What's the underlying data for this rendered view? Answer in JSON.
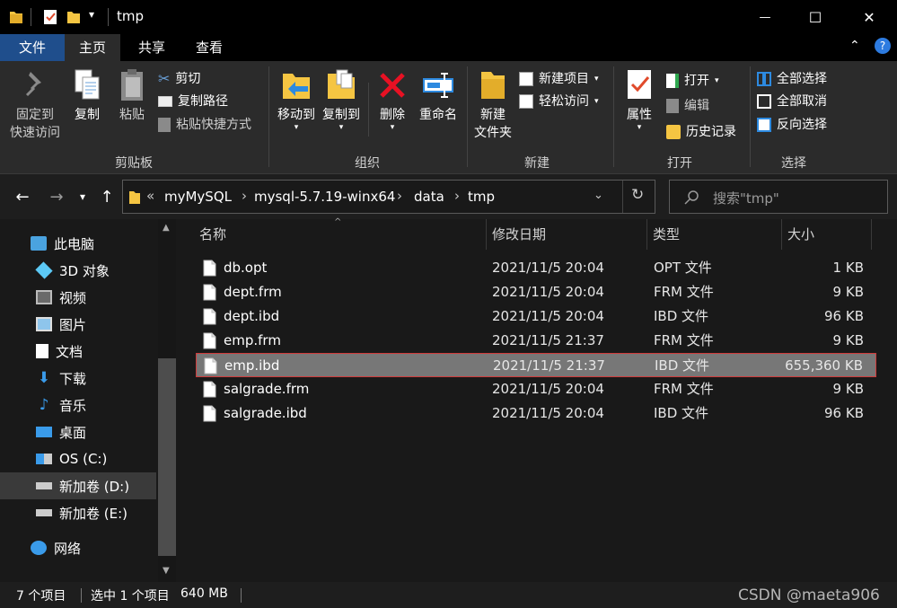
{
  "titlebar": {
    "title": "tmp",
    "qat_dropdown": "▾",
    "minimize": "—",
    "maximize": "☐",
    "close": "✕"
  },
  "tabs": [
    {
      "label": "文件"
    },
    {
      "label": "主页"
    },
    {
      "label": "共享"
    },
    {
      "label": "查看"
    }
  ],
  "ribbon": {
    "help": "?",
    "collapse": "⌃",
    "clipboard": {
      "group": "剪贴板",
      "pin_line1": "固定到",
      "pin_line2": "快速访问",
      "copy": "复制",
      "paste": "粘贴",
      "cut": "剪切",
      "copy_path": "复制路径",
      "paste_shortcut": "粘贴快捷方式"
    },
    "organize": {
      "group": "组织",
      "move_to": "移动到",
      "copy_to": "复制到",
      "delete": "删除",
      "rename": "重命名"
    },
    "new": {
      "group": "新建",
      "new_folder_line1": "新建",
      "new_folder_line2": "文件夹",
      "new_item": "新建项目",
      "easy_access": "轻松访问"
    },
    "open": {
      "group": "打开",
      "properties": "属性",
      "open": "打开",
      "edit": "编辑",
      "history": "历史记录"
    },
    "select": {
      "group": "选择",
      "select_all": "全部选择",
      "select_none": "全部取消",
      "invert": "反向选择"
    }
  },
  "address": {
    "overflow": "«",
    "crumbs": [
      "myMySQL",
      "mysql-5.7.19-winx64",
      "data",
      "tmp"
    ],
    "separator": "›",
    "search_placeholder": "搜索\"tmp\""
  },
  "nav": {
    "items": [
      {
        "label": "此电脑",
        "icon": "pc-icon"
      },
      {
        "label": "3D 对象",
        "icon": "cube-icon"
      },
      {
        "label": "视频",
        "icon": "video-icon"
      },
      {
        "label": "图片",
        "icon": "picture-icon"
      },
      {
        "label": "文档",
        "icon": "document-icon"
      },
      {
        "label": "下载",
        "icon": "download-icon"
      },
      {
        "label": "音乐",
        "icon": "music-icon"
      },
      {
        "label": "桌面",
        "icon": "desktop-icon"
      },
      {
        "label": "OS (C:)",
        "icon": "windows-drive-icon"
      },
      {
        "label": "新加卷 (D:)",
        "icon": "drive-icon"
      },
      {
        "label": "新加卷 (E:)",
        "icon": "drive-icon"
      },
      {
        "label": "网络",
        "icon": "network-icon"
      }
    ]
  },
  "filelist": {
    "columns": [
      "名称",
      "修改日期",
      "类型",
      "大小"
    ],
    "rows": [
      {
        "name": "db.opt",
        "date": "2021/11/5 20:04",
        "type": "OPT 文件",
        "size": "1 KB"
      },
      {
        "name": "dept.frm",
        "date": "2021/11/5 20:04",
        "type": "FRM 文件",
        "size": "9 KB"
      },
      {
        "name": "dept.ibd",
        "date": "2021/11/5 20:04",
        "type": "IBD 文件",
        "size": "96 KB"
      },
      {
        "name": "emp.frm",
        "date": "2021/11/5 21:37",
        "type": "FRM 文件",
        "size": "9 KB"
      },
      {
        "name": "emp.ibd",
        "date": "2021/11/5 21:37",
        "type": "IBD 文件",
        "size": "655,360 KB"
      },
      {
        "name": "salgrade.frm",
        "date": "2021/11/5 20:04",
        "type": "FRM 文件",
        "size": "9 KB"
      },
      {
        "name": "salgrade.ibd",
        "date": "2021/11/5 20:04",
        "type": "IBD 文件",
        "size": "96 KB"
      }
    ],
    "selected_index": 4
  },
  "status": {
    "count": "7 个项目",
    "selection": "选中 1 个项目",
    "size": "640 MB",
    "watermark": "CSDN @maeta906"
  },
  "colors": {
    "accent_tab": "#1f4e8c",
    "selection_row": "#777777",
    "selection_border": "#d03b3b",
    "folder_yellow": "#f5c542"
  }
}
